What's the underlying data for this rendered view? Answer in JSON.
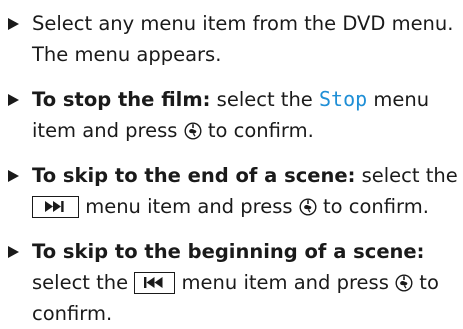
{
  "items": [
    {
      "line1": "Select any menu item from the DVD menu.",
      "line2": "The menu appears."
    },
    {
      "label": "To stop the film:",
      "line1_pre": "select the",
      "menu_term": "Stop",
      "line1_post": "menu",
      "line2_pre": "item and press",
      "line2_post": "to confirm."
    },
    {
      "label": "To skip to the end of a scene:",
      "line1_post": "select the",
      "button_icon": "skip-forward-icon",
      "line2_post": "menu item and press",
      "line2_end": "to confirm."
    },
    {
      "label": "To skip to the beginning of a scene:",
      "line2_pre": "select the",
      "button_icon": "skip-back-icon",
      "line2_mid": "menu item and press",
      "line2_end": "to",
      "line3": "confirm."
    }
  ],
  "icons": {
    "bullet": "triangle-right-bullet",
    "confirm": "controller-press-icon"
  }
}
